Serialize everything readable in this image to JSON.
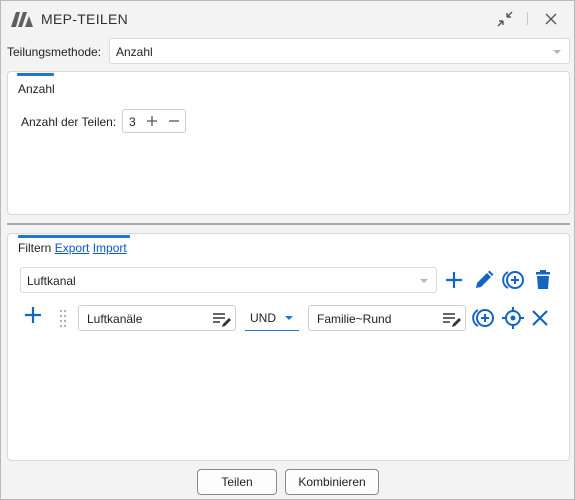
{
  "window": {
    "title": "MEP-TEILEN"
  },
  "method": {
    "label": "Teilungsmethode:",
    "value": "Anzahl"
  },
  "anzahl_panel": {
    "tab_label": "Anzahl",
    "count_label": "Anzahl der Teilen:",
    "count_value": "3"
  },
  "filter_panel": {
    "tab_label": "Filtern",
    "export_label": "Export",
    "import_label": "Import",
    "selected_filter": "Luftkanal",
    "rule": {
      "category": "Luftkanäle",
      "operator": "UND",
      "condition": "Familie~Rund"
    }
  },
  "footer": {
    "split_label": "Teilen",
    "combine_label": "Kombinieren"
  },
  "colors": {
    "accent": "#1976d2",
    "icon_blue": "#1565c0"
  }
}
